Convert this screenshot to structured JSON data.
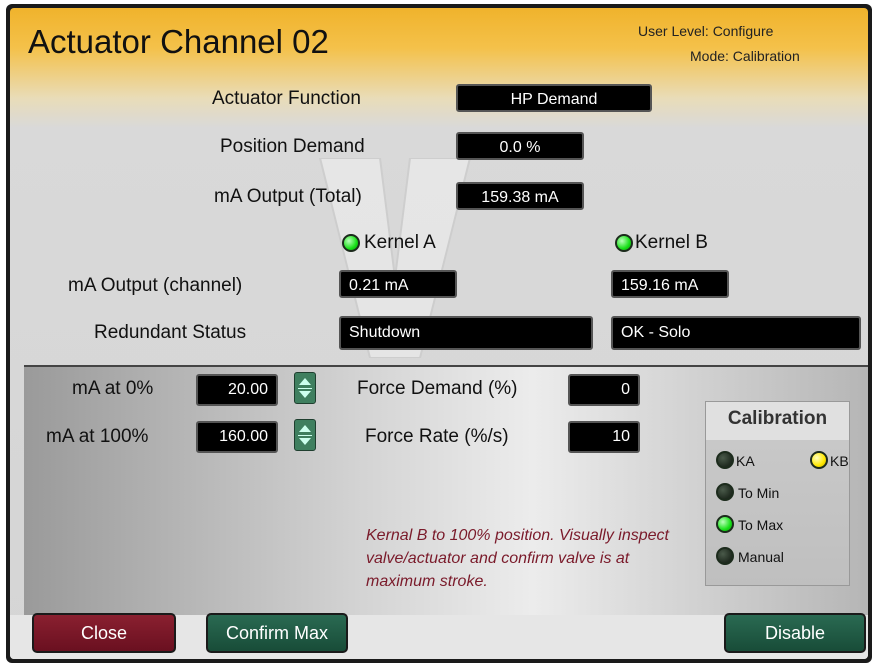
{
  "header": {
    "title": "Actuator Channel 02",
    "user_level": "User Level: Configure",
    "mode": "Mode: Calibration"
  },
  "top": {
    "actuator_function_label": "Actuator Function",
    "actuator_function_value": "HP Demand",
    "position_demand_label": "Position Demand",
    "position_demand_value": "0.0 %",
    "ma_output_total_label": "mA Output (Total)",
    "ma_output_total_value": "159.38 mA",
    "kernel_a_label": "Kernel A",
    "kernel_b_label": "Kernel B",
    "ma_output_channel_label": "mA Output (channel)",
    "ma_output_channel_a": "0.21 mA",
    "ma_output_channel_b": "159.16 mA",
    "redundant_status_label": "Redundant Status",
    "redundant_status_a": "Shutdown",
    "redundant_status_b": "OK - Solo"
  },
  "lower": {
    "ma_at_0_label": "mA at 0%",
    "ma_at_0_value": "20.00",
    "ma_at_100_label": "mA at 100%",
    "ma_at_100_value": "160.00",
    "force_demand_label": "Force Demand (%)",
    "force_demand_value": "0",
    "force_rate_label": "Force Rate (%/s)",
    "force_rate_value": "10",
    "message": "Kernal B to 100% position. Visually inspect valve/actuator and confirm valve is at maximum stroke."
  },
  "calibration": {
    "title": "Calibration",
    "ka": "KA",
    "kb": "KB",
    "to_min": "To Min",
    "to_max": "To Max",
    "manual": "Manual"
  },
  "buttons": {
    "close": "Close",
    "confirm_max": "Confirm Max",
    "disable": "Disable"
  },
  "colors": {
    "header_gold": "#f0b32c",
    "led_green": "#18e018",
    "led_yellow": "#ffe800",
    "message_red": "#7a1a2a",
    "button_red": "#8a2030",
    "button_green": "#2a6a52"
  }
}
